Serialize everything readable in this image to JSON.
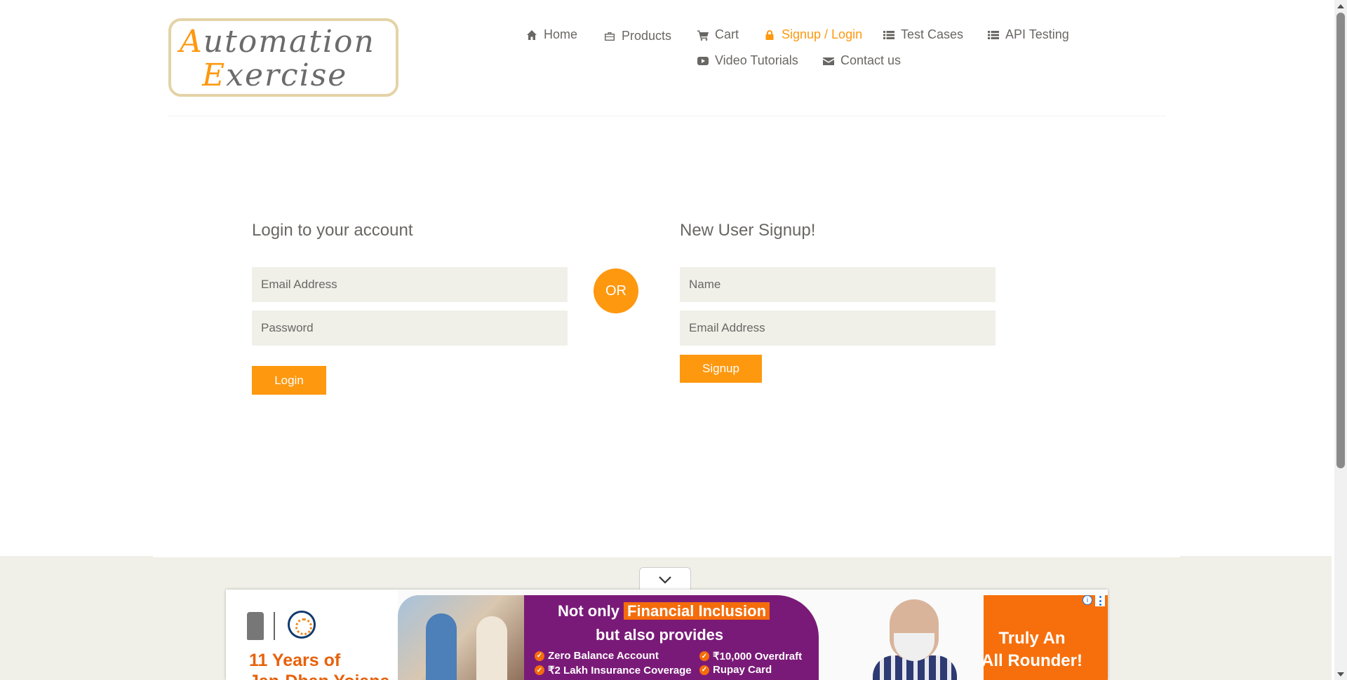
{
  "logo": {
    "line1_cap": "A",
    "line1_rest": "utomation",
    "line2_cap": "E",
    "line2_rest": "xercise"
  },
  "nav": {
    "home": "Home",
    "products": "Products",
    "cart": "Cart",
    "signup_login": "Signup / Login",
    "test_cases": "Test Cases",
    "api_testing": "API Testing",
    "video_tutorials": "Video Tutorials",
    "contact_us": "Contact us"
  },
  "login": {
    "title": "Login to your account",
    "email_placeholder": "Email Address",
    "password_placeholder": "Password",
    "button": "Login"
  },
  "separator": "OR",
  "signup": {
    "title": "New User Signup!",
    "name_placeholder": "Name",
    "email_placeholder": "Email Address",
    "button": "Signup"
  },
  "ad": {
    "years_line1": "11 Years of",
    "years_line2": "Jan-Dhan Yojana",
    "headline_prefix": "Not only",
    "headline_highlight": "Financial Inclusion",
    "subheadline": "but also provides",
    "benefits": [
      "Zero Balance Account",
      "₹10,000 Overdraft",
      "₹2 Lakh Insurance Coverage",
      "Rupay Card"
    ],
    "tagline_line1": "Truly An",
    "tagline_line2": "All Rounder!",
    "info": "i"
  },
  "colors": {
    "accent": "#fe980f",
    "text": "#696763",
    "input_bg": "#f0f0e9",
    "ad_purple": "#7a1a78",
    "ad_orange": "#f66f0c"
  },
  "icons": [
    "home-icon",
    "products-icon",
    "cart-icon",
    "lock-icon",
    "list-icon",
    "video-icon",
    "envelope-icon",
    "chevron-down-icon"
  ]
}
